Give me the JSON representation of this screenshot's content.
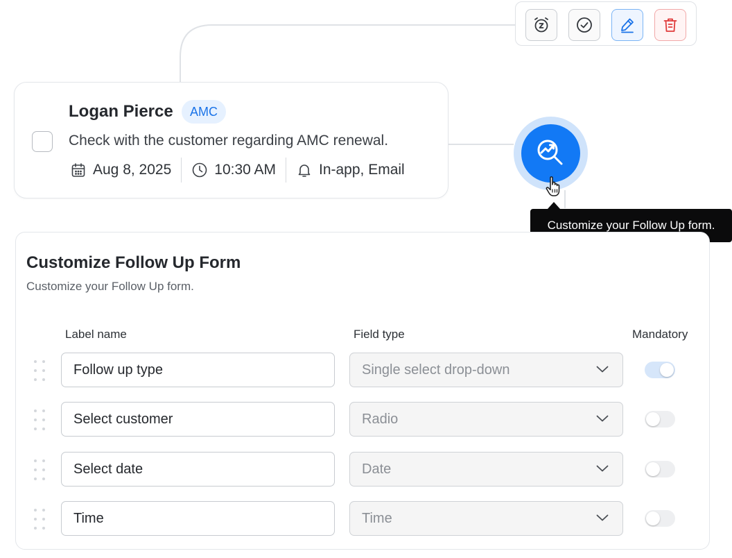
{
  "task": {
    "name": "Logan Pierce",
    "badge": "AMC",
    "description": "Check with the customer regarding AMC renewal.",
    "date": "Aug 8, 2025",
    "time": "10:30 AM",
    "channels": "In-app, Email",
    "completed": false
  },
  "toolbar": {
    "actions": [
      "snooze-icon",
      "check-icon",
      "edit-icon",
      "trash-icon"
    ]
  },
  "tooltip": {
    "text": "Customize your Follow Up form."
  },
  "form": {
    "title": "Customize Follow Up Form",
    "subtitle": "Customize your Follow Up form.",
    "columns": {
      "label": "Label name",
      "type": "Field type",
      "mandatory": "Mandatory"
    },
    "rows": [
      {
        "label": "Follow up type",
        "type": "Single select drop-down",
        "mandatory": true
      },
      {
        "label": "Select customer",
        "type": "Radio",
        "mandatory": false
      },
      {
        "label": "Select date",
        "type": "Date",
        "mandatory": false
      },
      {
        "label": "Time",
        "type": "Time",
        "mandatory": false
      }
    ]
  },
  "colors": {
    "accent": "#1279f5",
    "badge_bg": "#e6f1ff",
    "delete": "#e03b3b",
    "tooltip_bg": "#0b0b0c"
  }
}
